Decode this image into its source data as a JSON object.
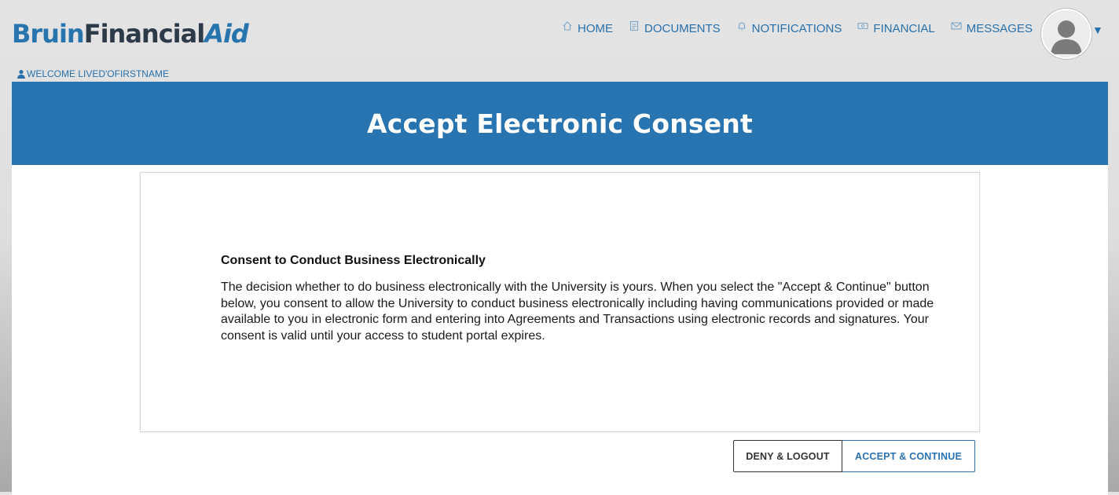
{
  "header": {
    "logo": {
      "part1": "Bruin",
      "part2": "Financial",
      "part3": "Aid"
    },
    "nav": [
      {
        "label": "HOME",
        "icon": "home-icon"
      },
      {
        "label": "DOCUMENTS",
        "icon": "document-icon"
      },
      {
        "label": "NOTIFICATIONS",
        "icon": "bell-icon"
      },
      {
        "label": "FINANCIAL",
        "icon": "money-icon"
      },
      {
        "label": "MESSAGES",
        "icon": "envelope-icon"
      }
    ],
    "user_menu_caret": "▼",
    "welcome": "WELCOME LIVED'OFIRSTNAME"
  },
  "banner": {
    "title": "Accept Electronic Consent"
  },
  "consent": {
    "heading": "Consent to Conduct Business Electronically",
    "body": "The decision whether to do business electronically with the University is yours. When you select the \"Accept & Continue\" button below, you consent to allow the University to conduct business electronically including having communications provided or made available to you in electronic form and entering into Agreements and Transactions using electronic records and signatures. Your consent is valid until your access to student portal expires."
  },
  "actions": {
    "deny_label": "DENY & LOGOUT",
    "accept_label": "ACCEPT & CONTINUE"
  },
  "colors": {
    "brand_blue": "#2874b0",
    "logo_dark": "#2d3a48",
    "link_blue": "#2870ab"
  }
}
